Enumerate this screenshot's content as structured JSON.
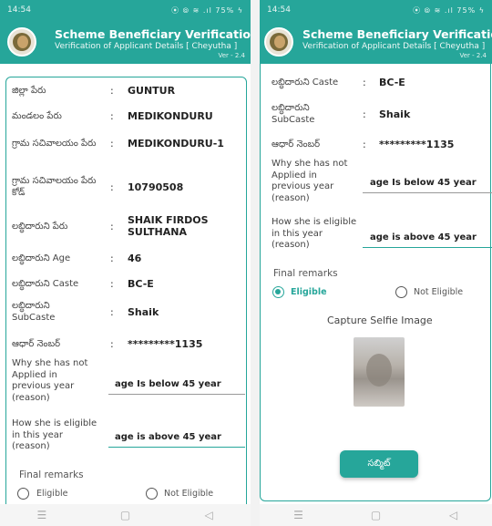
{
  "status": {
    "time": "14:54",
    "icons": "⦿ ⦾ ≋ .ıl 75% ϟ"
  },
  "app": {
    "title": "Scheme Beneficiary Verification",
    "subtitle": "Verification of Applicant Details [ Cheyutha ]",
    "version": "Ver - 2.4"
  },
  "colon": ":",
  "left": {
    "fields": [
      {
        "label": "జిల్లా పేరు",
        "value": "GUNTUR"
      },
      {
        "label": "మండలం పేరు",
        "value": "MEDIKONDURU"
      },
      {
        "label": "గ్రామ సచివాలయం పేరు",
        "value": "MEDIKONDURU-1"
      },
      {
        "label": "గ్రామ సచివాలయం పేరు కోడ్",
        "value": "10790508"
      },
      {
        "label": "లబ్ధిదారుని పేరు",
        "value": "SHAIK FIRDOS SULTHANA"
      },
      {
        "label": "లబ్ధిదారుని Age",
        "value": "46"
      },
      {
        "label": "లబ్ధిదారుని Caste",
        "value": "BC-E"
      },
      {
        "label": "లబ్ధిదారుని SubCaste",
        "value": "Shaik"
      },
      {
        "label": "ఆధార్ నెంబర్",
        "value": "*********1135"
      }
    ],
    "q1": "Why she has not Applied in previous year (reason)",
    "a1": "age Is below 45 year",
    "q2": "How she is eligible in this year (reason)",
    "a2": "age is above 45 year",
    "remarks_label": "Final remarks",
    "opt_eligible": "Eligible",
    "opt_not_eligible": "Not Eligible"
  },
  "right": {
    "fields": [
      {
        "label": "లబ్ధిదారుని Caste",
        "value": "BC-E"
      },
      {
        "label": "లబ్ధిదారుని SubCaste",
        "value": "Shaik"
      },
      {
        "label": "ఆధార్ నెంబర్",
        "value": "*********1135"
      }
    ],
    "q1": "Why she has not Applied in previous year (reason)",
    "a1": "age Is below 45 year",
    "q2": "How she is eligible in this year (reason)",
    "a2": "age is above 45 year",
    "remarks_label": "Final remarks",
    "opt_eligible": "Eligible",
    "opt_not_eligible": "Not Eligible",
    "capture_label": "Capture Selfie Image",
    "submit_label": "సబ్మిట్"
  },
  "nav": {
    "menu": "☰",
    "home": "▢",
    "back": "◁"
  },
  "colors": {
    "primary": "#26a69a"
  },
  "selected_remark": "Eligible"
}
